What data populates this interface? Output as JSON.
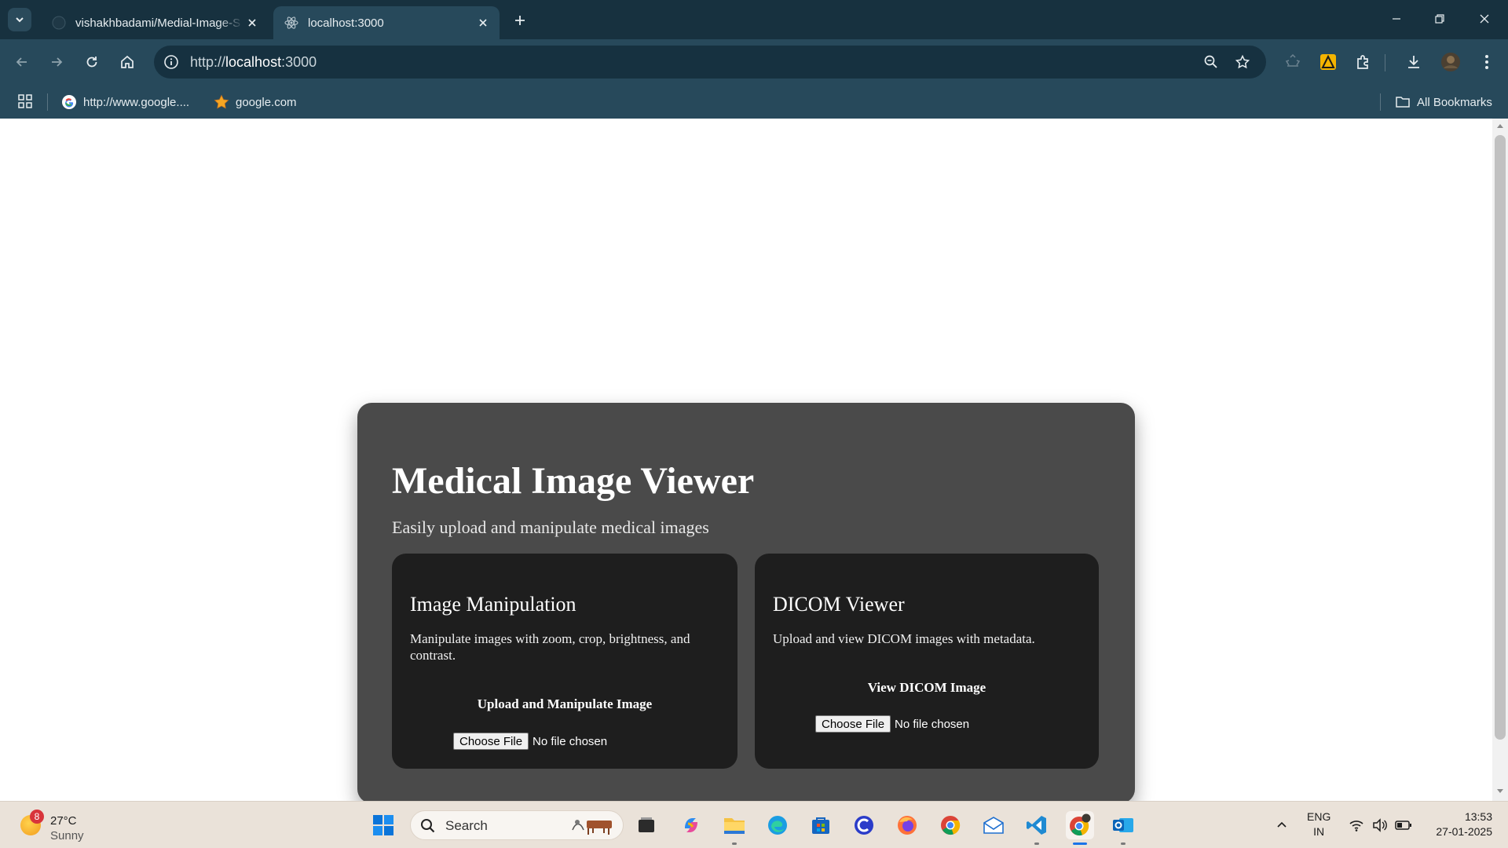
{
  "browser": {
    "tabs": [
      {
        "title": "vishakhbadami/Medial-Image-S",
        "active": false,
        "favicon": "github-icon"
      },
      {
        "title": "localhost:3000",
        "active": true,
        "favicon": "react-icon"
      }
    ],
    "address_bar": {
      "scheme": "http://",
      "host": "localhost",
      "port": ":3000"
    },
    "bookmarks": [
      {
        "label": "http://www.google....",
        "icon": "google-icon"
      },
      {
        "label": "google.com",
        "icon": "star-icon"
      }
    ],
    "all_bookmarks_label": "All Bookmarks"
  },
  "page": {
    "title": "Medical Image Viewer",
    "subtitle": "Easily upload and manipulate medical images",
    "cards": [
      {
        "title": "Image Manipulation",
        "description": "Manipulate images with zoom, crop, brightness, and contrast.",
        "action_label": "Upload and Manipulate Image",
        "file_button": "Choose File",
        "file_status": "No file chosen"
      },
      {
        "title": "DICOM Viewer",
        "description": "Upload and view DICOM images with metadata.",
        "action_label": "View DICOM Image",
        "file_button": "Choose File",
        "file_status": "No file chosen"
      }
    ]
  },
  "taskbar": {
    "weather": {
      "badge": "8",
      "temperature": "27°C",
      "condition": "Sunny"
    },
    "search_placeholder": "Search",
    "language": {
      "line1": "ENG",
      "line2": "IN"
    },
    "clock": {
      "time": "13:53",
      "date": "27-01-2025"
    }
  },
  "colors": {
    "titlebar": "#17313f",
    "toolbar": "#27495b",
    "main_card": "#4a4a4a",
    "feature_card": "#1e1e1e",
    "taskbar": "#eae2d9"
  }
}
